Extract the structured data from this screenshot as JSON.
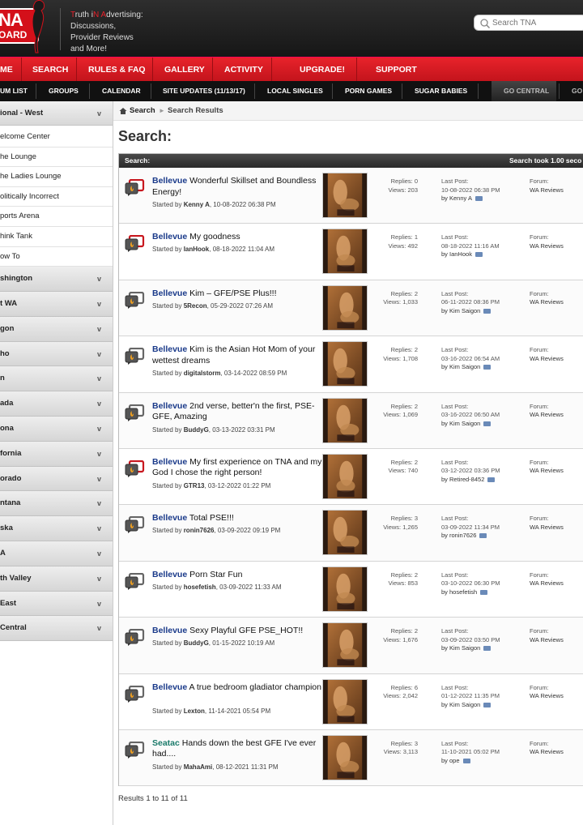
{
  "header": {
    "logo_top": "NA",
    "logo_bottom": "OARD",
    "tagline": [
      {
        "parts": [
          {
            "t": "T",
            "red": true
          },
          {
            "t": "ruth i",
            "red": false
          },
          {
            "t": "N",
            "red": true
          },
          {
            "t": " ",
            "red": false
          },
          {
            "t": "A",
            "red": true
          },
          {
            "t": "dvertising:",
            "red": false
          }
        ]
      },
      {
        "parts": [
          {
            "t": "Discussions,",
            "red": false
          }
        ]
      },
      {
        "parts": [
          {
            "t": "Provider Reviews",
            "red": false
          }
        ]
      },
      {
        "parts": [
          {
            "t": "and More!",
            "red": false
          }
        ]
      }
    ],
    "search_placeholder": "Search TNA"
  },
  "nav_main": {
    "home": "ME",
    "search": "SEARCH",
    "rules": "RULES & FAQ",
    "gallery": "GALLERY",
    "activity": "ACTIVITY",
    "upgrade": "UPGRADE!",
    "support": "SUPPORT"
  },
  "nav_sub": {
    "forum_list": "UM LIST",
    "groups": "GROUPS",
    "calendar": "CALENDAR",
    "site_updates": "SITE UPDATES (11/13/17)",
    "local_singles": "LOCAL SINGLES",
    "porn_games": "PORN GAMES",
    "sugar_babies": "SUGAR BABIES",
    "go_central": "GO CENTRAL",
    "go_more": "GO"
  },
  "sidebar": {
    "heading": "ional - West",
    "links": [
      "elcome Center",
      "he Lounge",
      "he Ladies Lounge",
      "olitically Incorrect",
      "ports Arena",
      "hink Tank",
      "ow To"
    ],
    "regions": [
      "shington",
      "t WA",
      "gon",
      "ho",
      "n",
      "ada",
      "ona",
      "fornia",
      "orado",
      "ntana",
      "ska",
      "A",
      "th Valley",
      "East",
      "Central"
    ],
    "chevron": "v"
  },
  "breadcrumb": {
    "search": "Search",
    "results": "Search Results"
  },
  "page_title": "Search:",
  "results_header": {
    "label": "Search:",
    "took": "Search took 1.00 seco"
  },
  "rows": [
    {
      "city": "Bellevue",
      "title": " Wonderful Skillset and Boundless Energy!",
      "started_prefix": "Started by ",
      "author": "Kenny A",
      "date": ", 10-08-2022 06:38 PM",
      "replies": "Replies: 0",
      "views": "Views: 203",
      "lp_label": "Last Post:",
      "lp_date": "10-08-2022 06:38 PM",
      "lp_by": "by Kenny A",
      "forum_label": "Forum:",
      "forum": "WA Reviews",
      "lines": 2,
      "icon_color": "#c8181f",
      "teal": false
    },
    {
      "city": "Bellevue",
      "title": " My goodness",
      "started_prefix": "Started by ",
      "author": "IanHook",
      "date": ", 08-18-2022 11:04 AM",
      "replies": "Replies: 1",
      "views": "Views: 492",
      "lp_label": "Last Post:",
      "lp_date": "08-18-2022 11:16 AM",
      "lp_by": "by IanHook",
      "forum_label": "Forum:",
      "forum": "WA Reviews",
      "lines": 1,
      "icon_color": "#c8181f",
      "teal": false
    },
    {
      "city": "Bellevue",
      "title": " Kim – GFE/PSE Plus!!!",
      "started_prefix": "Started by ",
      "author": "5Recon",
      "date": ", 05-29-2022 07:26 AM",
      "replies": "Replies: 2",
      "views": "Views: 1,033",
      "lp_label": "Last Post:",
      "lp_date": "06-11-2022 08:36 PM",
      "lp_by": "by Kim Saigon",
      "forum_label": "Forum:",
      "forum": "WA Reviews",
      "lines": 1,
      "icon_color": "#666666",
      "teal": false
    },
    {
      "city": "Bellevue",
      "title": " Kim is the Asian Hot Mom of your wettest dreams",
      "started_prefix": "Started by ",
      "author": "digitalstorm",
      "date": ", 03-14-2022 08:59 PM",
      "replies": "Replies: 2",
      "views": "Views: 1,708",
      "lp_label": "Last Post:",
      "lp_date": "03-16-2022 06:54 AM",
      "lp_by": "by Kim Saigon",
      "forum_label": "Forum:",
      "forum": "WA Reviews",
      "lines": 2,
      "icon_color": "#666666",
      "teal": false
    },
    {
      "city": "Bellevue",
      "title": " 2nd verse, better'n the first, PSE-GFE, Amazing",
      "started_prefix": "Started by ",
      "author": "BuddyG",
      "date": ", 03-13-2022 03:31 PM",
      "replies": "Replies: 2",
      "views": "Views: 1,069",
      "lp_label": "Last Post:",
      "lp_date": "03-16-2022 06:50 AM",
      "lp_by": "by Kim Saigon",
      "forum_label": "Forum:",
      "forum": "WA Reviews",
      "lines": 2,
      "icon_color": "#666666",
      "teal": false
    },
    {
      "city": "Bellevue",
      "title": " My first experience on TNA and my God I chose the right person!",
      "started_prefix": "Started by ",
      "author": "GTR13",
      "date": ", 03-12-2022 01:22 PM",
      "replies": "Replies: 2",
      "views": "Views: 740",
      "lp_label": "Last Post:",
      "lp_date": "03-12-2022 03:36 PM",
      "lp_by": "by Retired-8452",
      "forum_label": "Forum:",
      "forum": "WA Reviews",
      "lines": 2,
      "icon_color": "#c8181f",
      "teal": false
    },
    {
      "city": "Bellevue",
      "title": " Total PSE!!!",
      "started_prefix": "Started by ",
      "author": "ronin7626",
      "date": ", 03-09-2022 09:19 PM",
      "replies": "Replies: 3",
      "views": "Views: 1,265",
      "lp_label": "Last Post:",
      "lp_date": "03-09-2022 11:34 PM",
      "lp_by": "by ronin7626",
      "forum_label": "Forum:",
      "forum": "WA Reviews",
      "lines": 1,
      "icon_color": "#666666",
      "teal": false
    },
    {
      "city": "Bellevue",
      "title": " Porn Star Fun",
      "started_prefix": "Started by ",
      "author": "hosefetish",
      "date": ", 03-09-2022 11:33 AM",
      "replies": "Replies: 2",
      "views": "Views: 853",
      "lp_label": "Last Post:",
      "lp_date": "03-10-2022 06:30 PM",
      "lp_by": "by hosefetish",
      "forum_label": "Forum:",
      "forum": "WA Reviews",
      "lines": 1,
      "icon_color": "#666666",
      "teal": false
    },
    {
      "city": "Bellevue",
      "title": " Sexy Playful GFE PSE_HOT!!",
      "started_prefix": "Started by ",
      "author": "BuddyG",
      "date": ", 01-15-2022 10:19 AM",
      "replies": "Replies: 2",
      "views": "Views: 1,676",
      "lp_label": "Last Post:",
      "lp_date": "03-09-2022 03:50 PM",
      "lp_by": "by Kim Saigon",
      "forum_label": "Forum:",
      "forum": "WA Reviews",
      "lines": 1,
      "icon_color": "#666666",
      "teal": false
    },
    {
      "city": "Bellevue",
      "title": " A true bedroom gladiator champion",
      "started_prefix": "Started by ",
      "author": "Lexton",
      "date": ", 11-14-2021 05:54 PM",
      "replies": "Replies: 6",
      "views": "Views: 2,042",
      "lp_label": "Last Post:",
      "lp_date": "01-12-2022 11:35 PM",
      "lp_by": "by Kim Saigon",
      "forum_label": "Forum:",
      "forum": "WA Reviews",
      "lines": 2,
      "icon_color": "#666666",
      "teal": false
    },
    {
      "city": "Seatac",
      "title": " Hands down the best GFE I've ever had....",
      "started_prefix": "Started by ",
      "author": "MahaAmi",
      "date": ", 08-12-2021 11:31 PM",
      "replies": "Replies: 3",
      "views": "Views: 3,113",
      "lp_label": "Last Post:",
      "lp_date": "11-10-2021 05:02 PM",
      "lp_by": "by ope",
      "forum_label": "Forum:",
      "forum": "WA Reviews",
      "lines": 2,
      "icon_color": "#666666",
      "teal": true
    }
  ],
  "footer": "Results 1 to 11 of 11",
  "colors": {
    "red": "#d4101a",
    "navy_link": "#1a3a8a",
    "teal_link": "#1a7a6a"
  }
}
